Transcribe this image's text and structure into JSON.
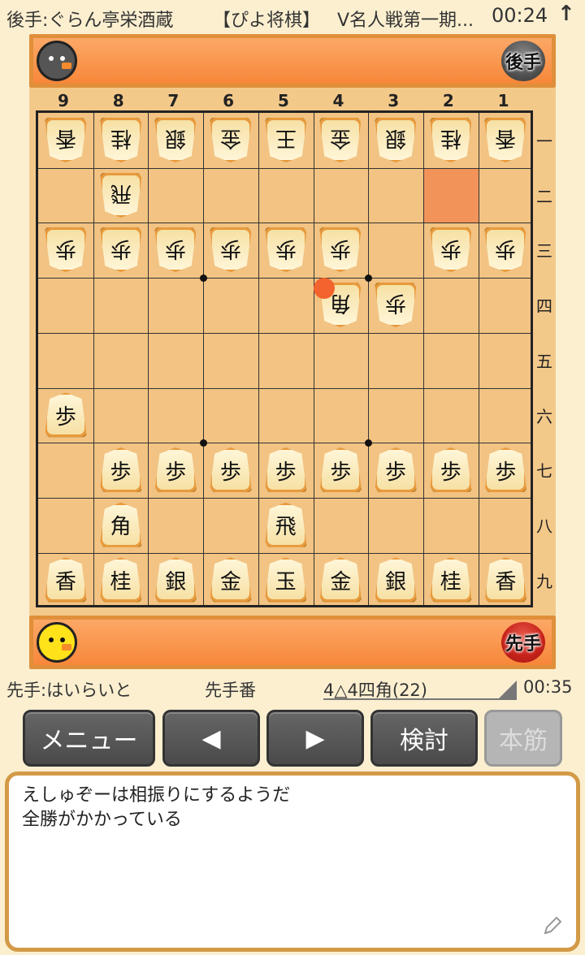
{
  "topbar": {
    "gote_player": "後手:ぐらん亭栄酒蔵",
    "app_name": "【ぴよ将棋】",
    "event": "V名人戦第一期...",
    "gote_time": "00:24",
    "flip_icon": "arrow-up-icon"
  },
  "badges": {
    "gote": "後手",
    "sente": "先手"
  },
  "board": {
    "columns": [
      "9",
      "8",
      "7",
      "6",
      "5",
      "4",
      "3",
      "2",
      "1"
    ],
    "rows": [
      "一",
      "二",
      "三",
      "四",
      "五",
      "六",
      "七",
      "八",
      "九"
    ],
    "highlight": {
      "file": 2,
      "rank": 2
    },
    "last_move_marker": {
      "file": 4,
      "rank": 4
    },
    "pieces": [
      {
        "file": 9,
        "rank": 1,
        "label": "香",
        "owner": "gote"
      },
      {
        "file": 8,
        "rank": 1,
        "label": "桂",
        "owner": "gote"
      },
      {
        "file": 7,
        "rank": 1,
        "label": "銀",
        "owner": "gote"
      },
      {
        "file": 6,
        "rank": 1,
        "label": "金",
        "owner": "gote"
      },
      {
        "file": 5,
        "rank": 1,
        "label": "王",
        "owner": "gote"
      },
      {
        "file": 4,
        "rank": 1,
        "label": "金",
        "owner": "gote"
      },
      {
        "file": 3,
        "rank": 1,
        "label": "銀",
        "owner": "gote"
      },
      {
        "file": 2,
        "rank": 1,
        "label": "桂",
        "owner": "gote"
      },
      {
        "file": 1,
        "rank": 1,
        "label": "香",
        "owner": "gote"
      },
      {
        "file": 8,
        "rank": 2,
        "label": "飛",
        "owner": "gote"
      },
      {
        "file": 9,
        "rank": 3,
        "label": "歩",
        "owner": "gote"
      },
      {
        "file": 8,
        "rank": 3,
        "label": "歩",
        "owner": "gote"
      },
      {
        "file": 7,
        "rank": 3,
        "label": "歩",
        "owner": "gote"
      },
      {
        "file": 6,
        "rank": 3,
        "label": "歩",
        "owner": "gote"
      },
      {
        "file": 5,
        "rank": 3,
        "label": "歩",
        "owner": "gote"
      },
      {
        "file": 4,
        "rank": 3,
        "label": "歩",
        "owner": "gote"
      },
      {
        "file": 2,
        "rank": 3,
        "label": "歩",
        "owner": "gote"
      },
      {
        "file": 1,
        "rank": 3,
        "label": "歩",
        "owner": "gote"
      },
      {
        "file": 4,
        "rank": 4,
        "label": "角",
        "owner": "gote"
      },
      {
        "file": 3,
        "rank": 4,
        "label": "歩",
        "owner": "gote"
      },
      {
        "file": 9,
        "rank": 6,
        "label": "歩",
        "owner": "sente"
      },
      {
        "file": 8,
        "rank": 7,
        "label": "歩",
        "owner": "sente"
      },
      {
        "file": 7,
        "rank": 7,
        "label": "歩",
        "owner": "sente"
      },
      {
        "file": 6,
        "rank": 7,
        "label": "歩",
        "owner": "sente"
      },
      {
        "file": 5,
        "rank": 7,
        "label": "歩",
        "owner": "sente"
      },
      {
        "file": 4,
        "rank": 7,
        "label": "歩",
        "owner": "sente"
      },
      {
        "file": 3,
        "rank": 7,
        "label": "歩",
        "owner": "sente"
      },
      {
        "file": 2,
        "rank": 7,
        "label": "歩",
        "owner": "sente"
      },
      {
        "file": 1,
        "rank": 7,
        "label": "歩",
        "owner": "sente"
      },
      {
        "file": 8,
        "rank": 8,
        "label": "角",
        "owner": "sente"
      },
      {
        "file": 5,
        "rank": 8,
        "label": "飛",
        "owner": "sente"
      },
      {
        "file": 9,
        "rank": 9,
        "label": "香",
        "owner": "sente"
      },
      {
        "file": 8,
        "rank": 9,
        "label": "桂",
        "owner": "sente"
      },
      {
        "file": 7,
        "rank": 9,
        "label": "銀",
        "owner": "sente"
      },
      {
        "file": 6,
        "rank": 9,
        "label": "金",
        "owner": "sente"
      },
      {
        "file": 5,
        "rank": 9,
        "label": "玉",
        "owner": "sente"
      },
      {
        "file": 4,
        "rank": 9,
        "label": "金",
        "owner": "sente"
      },
      {
        "file": 3,
        "rank": 9,
        "label": "銀",
        "owner": "sente"
      },
      {
        "file": 2,
        "rank": 9,
        "label": "桂",
        "owner": "sente"
      },
      {
        "file": 1,
        "rank": 9,
        "label": "香",
        "owner": "sente"
      }
    ]
  },
  "status": {
    "sente_player": "先手:はいらいと",
    "turn": "先手番",
    "last_move": "4△4四角(22)",
    "sente_time": "00:35"
  },
  "buttons": {
    "menu": "メニュー",
    "prev": "◀",
    "next": "▶",
    "analyze": "検討",
    "mainline": "本筋"
  },
  "comment": {
    "line1": "えしゅぞーは相振りにするようだ",
    "line2": "全勝がかかっている"
  },
  "colors": {
    "board": "#f2c383",
    "hand_tray": "#f7873a",
    "highlight": "#f2945a",
    "last_move_dot": "#f2632d",
    "button": "#4a4a4a"
  }
}
